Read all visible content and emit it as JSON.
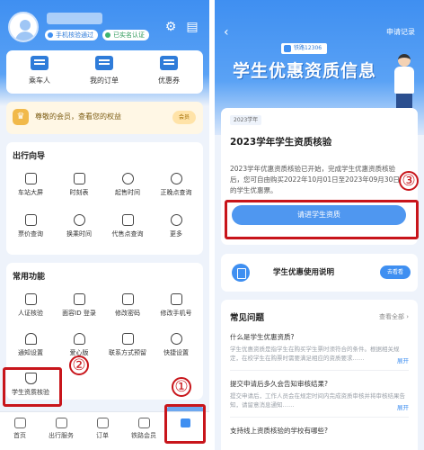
{
  "left": {
    "user": {
      "name": "",
      "badge_phone": "手机核验通过",
      "badge_id": "已实名认证"
    },
    "header_icons": [
      "gear-icon",
      "message-icon"
    ],
    "quick_actions": [
      {
        "label": "乘车人",
        "icon": "passenger-icon"
      },
      {
        "label": "我的订单",
        "icon": "order-icon"
      },
      {
        "label": "优惠券",
        "icon": "coupon-icon"
      }
    ],
    "member": {
      "text": "尊敬的会员，查看您的权益",
      "button": "会员"
    },
    "travel_guide": {
      "title": "出行向导",
      "items": [
        "车站大屏",
        "时刻表",
        "起售时间",
        "正晚点查询",
        "票价查询",
        "换乘时间",
        "代售点查询",
        "更多"
      ]
    },
    "common": {
      "title": "常用功能",
      "items": [
        "人证核验",
        "面容ID 登录",
        "修改密码",
        "修改手机号",
        "通知设置",
        "爱心版",
        "联系方式预留",
        "快捷设置",
        "学生资质核验"
      ]
    },
    "tabs": [
      "首页",
      "出行服务",
      "订单",
      "铁路会员",
      "我的"
    ],
    "active_tab": 4,
    "callouts": [
      "①",
      "②"
    ]
  },
  "right": {
    "nav": {
      "back": "‹",
      "record": "申请记录"
    },
    "banner": {
      "tag": "铁路12306",
      "title": "学生优惠资质信息"
    },
    "card": {
      "year_tag": "2023学年",
      "title": "2023学年学生资质核验",
      "body": "2023学年优惠资质核验已开始，完成学生优惠资质核验后，您可自由购买2022年10月01日至2023年09月30日的学生优惠票。",
      "button": "请进学生资质"
    },
    "callout": "③",
    "usage": {
      "text": "学生优惠使用说明",
      "button": "去看看"
    },
    "faq": {
      "title": "常见问题",
      "more": "查看全部 ›",
      "items": [
        {
          "q": "什么是学生优惠资质?",
          "a": "学生优惠资质是指学生在购买学生票时须符合的条件。根据相关规定，在校学生在购票时需要满足相应的资质要求……",
          "expand": "展开"
        },
        {
          "q": "提交申请后多久会告知审核结果?",
          "a": "提交申请后，工作人员会在规定时间内完成资质审核并将审核结果告知，请留意消息通知……",
          "expand": "展开"
        },
        {
          "q": "支持线上资质核验的学校有哪些?",
          "a": "",
          "expand": ""
        }
      ]
    }
  }
}
